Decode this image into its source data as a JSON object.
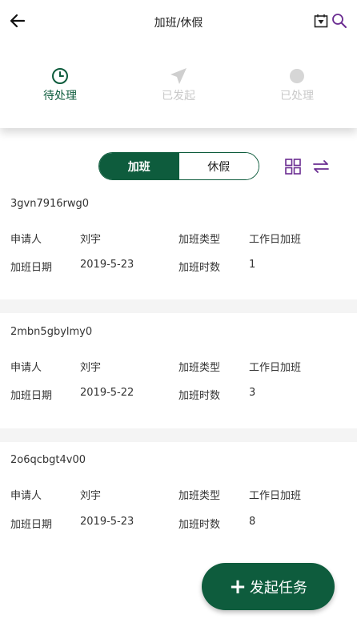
{
  "header": {
    "title": "加班/休假",
    "icons": {
      "back": "back-arrow-icon",
      "calendar": "calendar-icon",
      "search": "search-icon"
    }
  },
  "status_tabs": [
    {
      "label": "待处理",
      "icon": "clock-icon",
      "active": true
    },
    {
      "label": "已发起",
      "icon": "send-icon",
      "active": false
    },
    {
      "label": "已处理",
      "icon": "dot-icon",
      "active": false
    }
  ],
  "segment": {
    "overtime": "加班",
    "leave": "休假",
    "selected": "overtime"
  },
  "labels": {
    "applicant": "申请人",
    "type": "加班类型",
    "date": "加班日期",
    "hours": "加班时数"
  },
  "records": [
    {
      "id": "3gvn7916rwg0",
      "applicant": "刘宇",
      "type": "工作日加班",
      "date": "2019-5-23",
      "hours": "1"
    },
    {
      "id": "2mbn5gbylmy0",
      "applicant": "刘宇",
      "type": "工作日加班",
      "date": "2019-5-22",
      "hours": "3"
    },
    {
      "id": "2o6qcbgt4v00",
      "applicant": "刘宇",
      "type": "工作日加班",
      "date": "2019-5-23",
      "hours": "8"
    }
  ],
  "fab": {
    "plus": "+",
    "label": "发起任务"
  },
  "colors": {
    "accent": "#0e5c3d",
    "icon_purple": "#6a2c91",
    "disabled": "#c9c9c9",
    "separator": "#f4f4f4"
  }
}
